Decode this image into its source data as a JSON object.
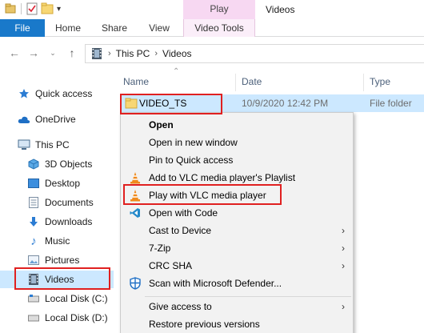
{
  "titlebar": {
    "play_tab": "Play",
    "window_title": "Videos"
  },
  "ribbon": {
    "tabs": [
      "File",
      "Home",
      "Share",
      "View",
      "Video Tools"
    ]
  },
  "address": {
    "crumbs": [
      "This PC",
      "Videos"
    ]
  },
  "navpane": {
    "items": [
      "Quick access",
      "OneDrive",
      "This PC",
      "3D Objects",
      "Desktop",
      "Documents",
      "Downloads",
      "Music",
      "Pictures",
      "Videos",
      "Local Disk (C:)",
      "Local Disk (D:)"
    ],
    "selected": "Videos"
  },
  "filelist": {
    "columns": [
      "Name",
      "Date",
      "Type"
    ],
    "rows": [
      {
        "name": "VIDEO_TS",
        "date": "10/9/2020 12:42 PM",
        "type": "File folder"
      }
    ]
  },
  "context_menu": {
    "items": [
      "Open",
      "Open in new window",
      "Pin to Quick access",
      "Add to VLC media player's Playlist",
      "Play with VLC media player",
      "Open with Code",
      "Cast to Device",
      "7-Zip",
      "CRC SHA",
      "Scan with Microsoft Defender...",
      "Give access to",
      "Restore previous versions"
    ]
  },
  "colors": {
    "file_tab": "#1979ca",
    "selection": "#cce8ff",
    "highlight_box": "#e02020",
    "play_context": "#f7d8f2"
  }
}
